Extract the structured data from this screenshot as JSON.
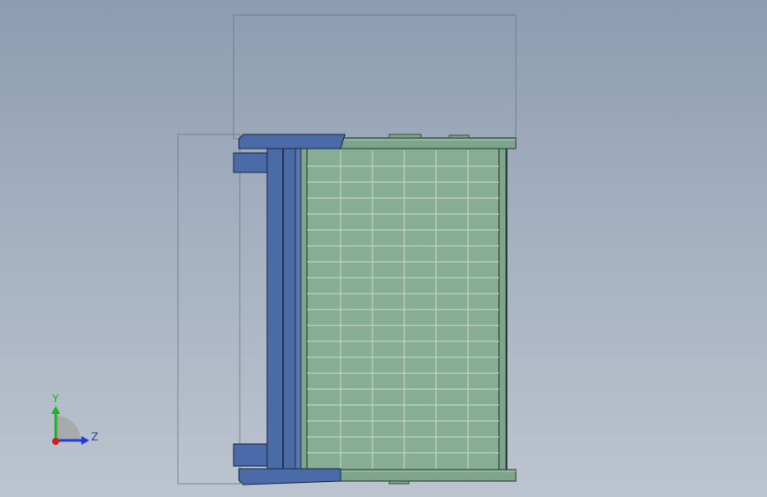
{
  "viewport": {
    "background_top": "#8d9cb1",
    "background_bottom": "#bcc4cf",
    "model": {
      "frame_color": "#4a6ba8",
      "frame_edge": "#1d2a44",
      "screen_color": "#7fa48c",
      "screen_edge": "#24382c",
      "mesh_line": "#c9dccb"
    },
    "dimensions": {
      "top_value": "",
      "left_value": ""
    }
  },
  "triad": {
    "y_label": "Y",
    "z_label": "Z",
    "y_color": "#1fb31f",
    "z_color": "#1f3fd0",
    "x_color": "#d01f1f"
  }
}
